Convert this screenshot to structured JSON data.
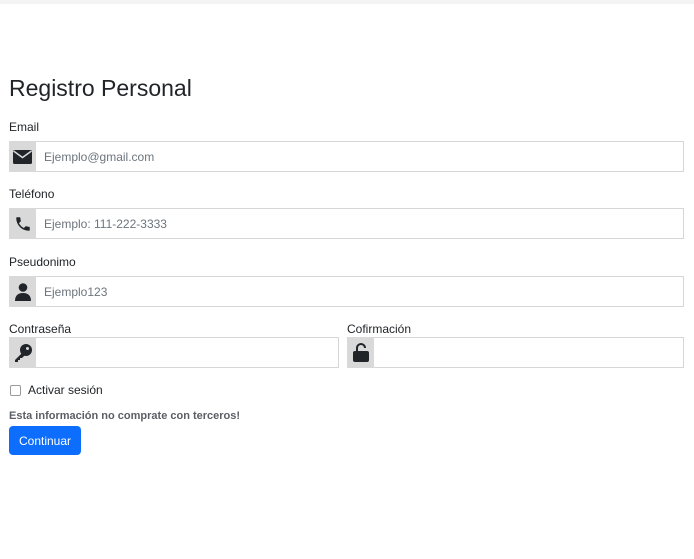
{
  "form": {
    "title": "Registro Personal",
    "email": {
      "label": "Email",
      "placeholder": "Ejemplo@gmail.com",
      "value": "",
      "icon": "envelope-icon"
    },
    "phone": {
      "label": "Teléfono",
      "placeholder": "Ejemplo: 111-222-3333",
      "value": "",
      "icon": "phone-icon"
    },
    "nickname": {
      "label": "Pseudonimo",
      "placeholder": "Ejemplo123",
      "value": "",
      "icon": "user-icon"
    },
    "password": {
      "label": "Contraseña",
      "placeholder": "",
      "value": "",
      "icon": "key-icon"
    },
    "confirmation": {
      "label": "Cofirmación",
      "placeholder": "",
      "value": "",
      "icon": "unlock-icon"
    },
    "remember": {
      "label": "Activar sesión",
      "checked": false
    },
    "note": "Esta información no comprate con terceros!",
    "submit_label": "Continuar"
  },
  "colors": {
    "primary": "#0d6efd",
    "addon_bg": "#d9d9d9",
    "text": "#212529",
    "placeholder": "#6c757d"
  }
}
